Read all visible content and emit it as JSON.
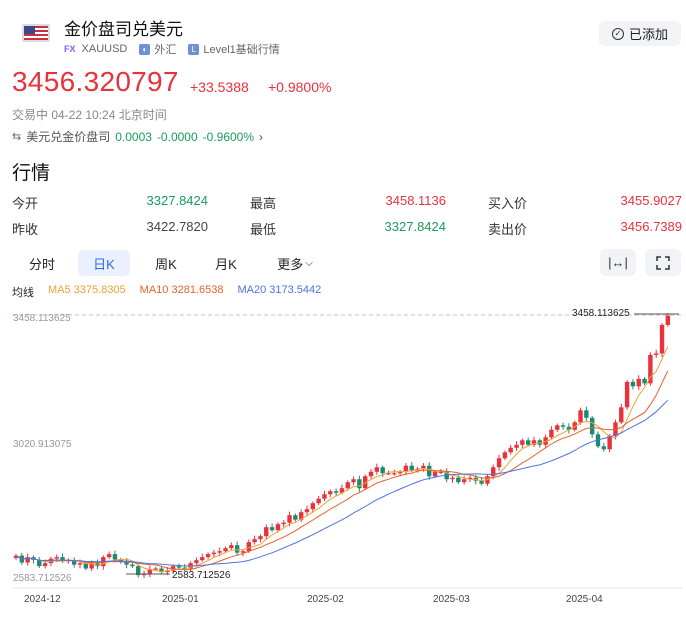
{
  "header": {
    "title": "金价盘司兑美元",
    "fx_tag": "FX",
    "symbol": "XAUUSD",
    "market": "外汇",
    "level": "Level1基础行情",
    "added_label": "已添加"
  },
  "quote": {
    "price": "3456.320797",
    "change": "+33.5388",
    "change_pct": "+0.9800%",
    "status": "交易中 04-22 10:24 北京时间"
  },
  "inverse": {
    "label": "美元兑金价盘司",
    "price": "0.0003",
    "change": "-0.0000",
    "change_pct": "-0.9600%"
  },
  "section_title": "行情",
  "stats": {
    "open_label": "今开",
    "open": "3327.8424",
    "high_label": "最高",
    "high": "3458.1136",
    "bid_label": "买入价",
    "bid": "3455.9027",
    "prev_close_label": "昨收",
    "prev_close": "3422.7820",
    "low_label": "最低",
    "low": "3327.8424",
    "ask_label": "卖出价",
    "ask": "3456.7389"
  },
  "tabs": [
    {
      "label": "分时",
      "active": false
    },
    {
      "label": "日K",
      "active": true
    },
    {
      "label": "周K",
      "active": false
    },
    {
      "label": "月K",
      "active": false
    },
    {
      "label": "更多",
      "active": false
    }
  ],
  "ma_legend": {
    "title": "均线",
    "ma5": "MA5 3375.8305",
    "ma10": "MA10 3281.6538",
    "ma20": "MA20 3173.5442"
  },
  "colors": {
    "up": "#e8323c",
    "down": "#1b8a75",
    "ma5": "#f0a232",
    "ma10": "#e8602c",
    "ma20": "#4b74e0",
    "accent": "#2f6bea"
  },
  "chart_data": {
    "type": "candlestick",
    "y_axis_labels": [
      "3458.113625",
      "3020.913075",
      "2583.712526"
    ],
    "ylim": [
      2583.712526,
      3458.113625
    ],
    "x_tick_labels": [
      "2024-12",
      "2025-01",
      "2025-02",
      "2025-03",
      "2025-04"
    ],
    "max_marker": "3458.113625",
    "min_marker": "2583.712526",
    "closes": [
      2655,
      2632,
      2650,
      2641,
      2620,
      2630,
      2645,
      2650,
      2636,
      2640,
      2625,
      2630,
      2612,
      2630,
      2620,
      2650,
      2660,
      2642,
      2638,
      2625,
      2620,
      2590,
      2595,
      2610,
      2612,
      2600,
      2605,
      2620,
      2615,
      2612,
      2630,
      2640,
      2650,
      2660,
      2665,
      2670,
      2680,
      2690,
      2665,
      2670,
      2700,
      2710,
      2720,
      2750,
      2740,
      2760,
      2765,
      2790,
      2775,
      2800,
      2810,
      2830,
      2845,
      2860,
      2870,
      2865,
      2880,
      2900,
      2910,
      2880,
      2920,
      2935,
      2950,
      2930,
      2930,
      2930,
      2935,
      2955,
      2940,
      2945,
      2955,
      2920,
      2935,
      2935,
      2910,
      2915,
      2900,
      2910,
      2915,
      2905,
      2895,
      2920,
      2950,
      2980,
      3000,
      3015,
      3025,
      3040,
      3025,
      3040,
      3025,
      3050,
      3075,
      3090,
      3085,
      3075,
      3100,
      3140,
      3115,
      3060,
      3020,
      3010,
      3055,
      3100,
      3150,
      3235,
      3220,
      3245,
      3230,
      3325,
      3330,
      3425,
      3456
    ]
  }
}
